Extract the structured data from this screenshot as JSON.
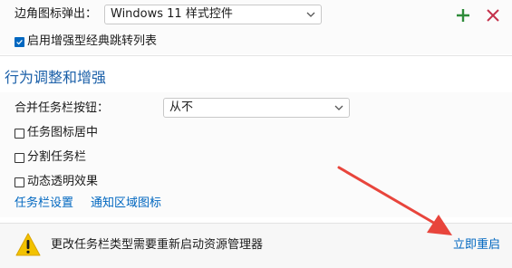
{
  "top": {
    "corner_icon_label": "边角图标弹出：",
    "corner_icon_select": "Windows 11 样式控件",
    "enhanced_jumplist_label": "启用增强型经典跳转列表",
    "enhanced_jumplist_checked": true,
    "add_icon": "plus-icon",
    "remove_icon": "close-icon"
  },
  "section": {
    "title": "行为调整和增强"
  },
  "behavior": {
    "combine_label": "合并任务栏按钮：",
    "combine_select": "从不",
    "center_icons_label": "任务图标居中",
    "center_icons_checked": false,
    "split_label": "分割任务栏",
    "split_checked": false,
    "transparency_label": "动态透明效果",
    "transparency_checked": false,
    "link_taskbar_settings": "任务栏设置",
    "link_tray_icons": "通知区域图标"
  },
  "notice": {
    "icon": "warning-icon",
    "message": "更改任务栏类型需要重新启动资源管理器",
    "restart_link": "立即重启"
  },
  "colors": {
    "accent": "#0067c0",
    "plus": "#2e8b3a",
    "close": "#c4314b",
    "warning": "#f2c200",
    "arrow": "#e8453c"
  }
}
